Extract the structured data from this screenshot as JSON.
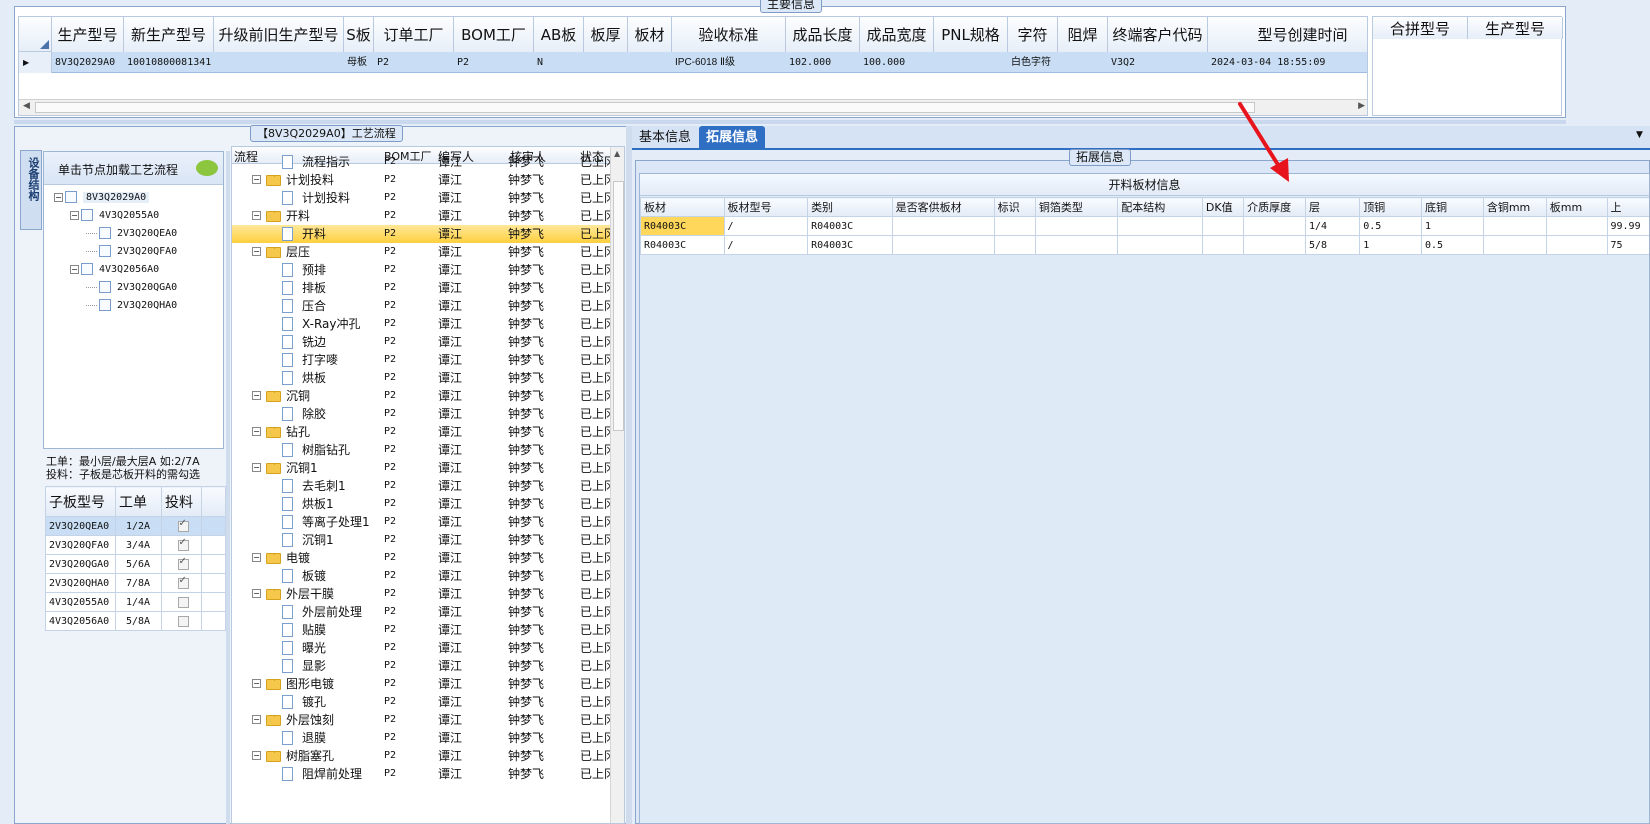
{
  "main_info": {
    "title": "主要信息",
    "columns": [
      "生产型号",
      "新生产型号",
      "升级前旧生产型号",
      "S板",
      "订单工厂",
      "BOM工厂",
      "AB板",
      "板厚",
      "板材",
      "验收标准",
      "成品长度",
      "成品宽度",
      "PNL规格",
      "字符",
      "阻焊",
      "终端客户代码",
      "型号创建时间"
    ],
    "row": [
      "8V3Q2029A0",
      "10010800081341",
      "",
      "母板",
      "P2",
      "P2",
      "N",
      "",
      "",
      "IPC-6018 Ⅱ级",
      "102.000",
      "100.000",
      "",
      "白色字符",
      "",
      "V3Q2",
      "2024-03-04 18:55:09"
    ]
  },
  "merge_panel": {
    "columns": [
      "合拼型号",
      "生产型号"
    ]
  },
  "left_tab": {
    "label": "设备结构"
  },
  "tree": {
    "hint": "单击节点加载工艺流程",
    "nodes": [
      {
        "label": "8V3Q2029A0",
        "level": 0
      },
      {
        "label": "4V3Q2055A0",
        "level": 1
      },
      {
        "label": "2V3Q20QEA0",
        "level": 2
      },
      {
        "label": "2V3Q20QFA0",
        "level": 2
      },
      {
        "label": "4V3Q2056A0",
        "level": 1
      },
      {
        "label": "2V3Q20QGA0",
        "level": 2
      },
      {
        "label": "2V3Q20QHA0",
        "level": 2
      }
    ]
  },
  "workorder_note": {
    "line1": "工单：最小层/最大层A 如:2/7A",
    "line2": "投料：子板是芯板开料的需勾选"
  },
  "sub_grid": {
    "columns": [
      "子板型号",
      "工单",
      "投料"
    ],
    "rows": [
      {
        "model": "2V3Q20QEA0",
        "wo": "1/2A",
        "feed": true
      },
      {
        "model": "2V3Q20QFA0",
        "wo": "3/4A",
        "feed": true
      },
      {
        "model": "2V3Q20QGA0",
        "wo": "5/6A",
        "feed": true
      },
      {
        "model": "2V3Q20QHA0",
        "wo": "7/8A",
        "feed": true
      },
      {
        "model": "4V3Q2055A0",
        "wo": "1/4A",
        "feed": false
      },
      {
        "model": "4V3Q2056A0",
        "wo": "5/8A",
        "feed": false
      }
    ]
  },
  "flow": {
    "title": "【8V3Q2029A0】工艺流程",
    "columns": [
      "流程",
      "BOM工厂",
      "编写人",
      "核审人",
      "状态"
    ],
    "rows": [
      {
        "name": "流程指示",
        "folder": false,
        "bom": "P2",
        "writer": "谭江",
        "auditor": "钟梦飞",
        "status": "已上冈"
      },
      {
        "name": "计划投料",
        "folder": true,
        "bom": "P2",
        "writer": "谭江",
        "auditor": "钟梦飞",
        "status": "已上冈"
      },
      {
        "name": "计划投料",
        "folder": false,
        "bom": "P2",
        "writer": "谭江",
        "auditor": "钟梦飞",
        "status": "已上冈"
      },
      {
        "name": "开料",
        "folder": true,
        "bom": "P2",
        "writer": "谭江",
        "auditor": "钟梦飞",
        "status": "已上冈"
      },
      {
        "name": "开料",
        "folder": false,
        "bom": "P2",
        "writer": "谭江",
        "auditor": "钟梦飞",
        "status": "已上冈",
        "selected": true
      },
      {
        "name": "层压",
        "folder": true,
        "bom": "P2",
        "writer": "谭江",
        "auditor": "钟梦飞",
        "status": "已上冈"
      },
      {
        "name": "预排",
        "folder": false,
        "bom": "P2",
        "writer": "谭江",
        "auditor": "钟梦飞",
        "status": "已上冈"
      },
      {
        "name": "排板",
        "folder": false,
        "bom": "P2",
        "writer": "谭江",
        "auditor": "钟梦飞",
        "status": "已上冈"
      },
      {
        "name": "压合",
        "folder": false,
        "bom": "P2",
        "writer": "谭江",
        "auditor": "钟梦飞",
        "status": "已上冈"
      },
      {
        "name": "X-Ray冲孔",
        "folder": false,
        "bom": "P2",
        "writer": "谭江",
        "auditor": "钟梦飞",
        "status": "已上冈"
      },
      {
        "name": "铣边",
        "folder": false,
        "bom": "P2",
        "writer": "谭江",
        "auditor": "钟梦飞",
        "status": "已上冈"
      },
      {
        "name": "打字嘜",
        "folder": false,
        "bom": "P2",
        "writer": "谭江",
        "auditor": "钟梦飞",
        "status": "已上冈"
      },
      {
        "name": "烘板",
        "folder": false,
        "bom": "P2",
        "writer": "谭江",
        "auditor": "钟梦飞",
        "status": "已上冈"
      },
      {
        "name": "沉铜",
        "folder": true,
        "bom": "P2",
        "writer": "谭江",
        "auditor": "钟梦飞",
        "status": "已上冈"
      },
      {
        "name": "除胶",
        "folder": false,
        "bom": "P2",
        "writer": "谭江",
        "auditor": "钟梦飞",
        "status": "已上冈"
      },
      {
        "name": "钻孔",
        "folder": true,
        "bom": "P2",
        "writer": "谭江",
        "auditor": "钟梦飞",
        "status": "已上冈"
      },
      {
        "name": "树脂钻孔",
        "folder": false,
        "bom": "P2",
        "writer": "谭江",
        "auditor": "钟梦飞",
        "status": "已上冈"
      },
      {
        "name": "沉铜1",
        "folder": true,
        "bom": "P2",
        "writer": "谭江",
        "auditor": "钟梦飞",
        "status": "已上冈"
      },
      {
        "name": "去毛刺1",
        "folder": false,
        "bom": "P2",
        "writer": "谭江",
        "auditor": "钟梦飞",
        "status": "已上冈"
      },
      {
        "name": "烘板1",
        "folder": false,
        "bom": "P2",
        "writer": "谭江",
        "auditor": "钟梦飞",
        "status": "已上冈"
      },
      {
        "name": "等离子处理1",
        "folder": false,
        "bom": "P2",
        "writer": "谭江",
        "auditor": "钟梦飞",
        "status": "已上冈"
      },
      {
        "name": "沉铜1",
        "folder": false,
        "bom": "P2",
        "writer": "谭江",
        "auditor": "钟梦飞",
        "status": "已上冈"
      },
      {
        "name": "电镀",
        "folder": true,
        "bom": "P2",
        "writer": "谭江",
        "auditor": "钟梦飞",
        "status": "已上冈"
      },
      {
        "name": "板镀",
        "folder": false,
        "bom": "P2",
        "writer": "谭江",
        "auditor": "钟梦飞",
        "status": "已上冈"
      },
      {
        "name": "外层干膜",
        "folder": true,
        "bom": "P2",
        "writer": "谭江",
        "auditor": "钟梦飞",
        "status": "已上冈"
      },
      {
        "name": "外层前处理",
        "folder": false,
        "bom": "P2",
        "writer": "谭江",
        "auditor": "钟梦飞",
        "status": "已上冈"
      },
      {
        "name": "贴膜",
        "folder": false,
        "bom": "P2",
        "writer": "谭江",
        "auditor": "钟梦飞",
        "status": "已上冈"
      },
      {
        "name": "曝光",
        "folder": false,
        "bom": "P2",
        "writer": "谭江",
        "auditor": "钟梦飞",
        "status": "已上冈"
      },
      {
        "name": "显影",
        "folder": false,
        "bom": "P2",
        "writer": "谭江",
        "auditor": "钟梦飞",
        "status": "已上冈"
      },
      {
        "name": "图形电镀",
        "folder": true,
        "bom": "P2",
        "writer": "谭江",
        "auditor": "钟梦飞",
        "status": "已上冈"
      },
      {
        "name": "镀孔",
        "folder": false,
        "bom": "P2",
        "writer": "谭江",
        "auditor": "钟梦飞",
        "status": "已上冈"
      },
      {
        "name": "外层蚀刻",
        "folder": true,
        "bom": "P2",
        "writer": "谭江",
        "auditor": "钟梦飞",
        "status": "已上冈"
      },
      {
        "name": "退膜",
        "folder": false,
        "bom": "P2",
        "writer": "谭江",
        "auditor": "钟梦飞",
        "status": "已上冈"
      },
      {
        "name": "树脂塞孔",
        "folder": true,
        "bom": "P2",
        "writer": "谭江",
        "auditor": "钟梦飞",
        "status": "已上冈"
      },
      {
        "name": "阻焊前处理",
        "folder": false,
        "bom": "P2",
        "writer": "谭江",
        "auditor": "钟梦飞",
        "status": "已上冈"
      }
    ]
  },
  "right_tabs": [
    {
      "label": "基本信息",
      "active": false
    },
    {
      "label": "拓展信息",
      "active": true
    }
  ],
  "ext": {
    "group_title": "拓展信息",
    "table_title": "开料板材信息",
    "columns": [
      "板材",
      "板材型号",
      "类别",
      "是否客供板材",
      "标识",
      "铜箔类型",
      "配本结构",
      "DK值",
      "介质厚度",
      "层",
      "顶铜",
      "底铜",
      "含铜mm",
      "板mm",
      "上"
    ],
    "rows": [
      [
        "R04003C",
        "/",
        "R04003C",
        "",
        "",
        "",
        "",
        "",
        "",
        "1/4",
        "0.5",
        "1",
        "",
        "",
        "99.99"
      ],
      [
        "R04003C",
        "/",
        "R04003C",
        "",
        "",
        "",
        "",
        "",
        "",
        "5/8",
        "1",
        "0.5",
        "",
        "",
        "75"
      ]
    ]
  },
  "colors": {
    "accent": "#2f6fc3",
    "selection": "#c9def5",
    "arrow": "#e8141c",
    "highlight": "#ffd75a"
  }
}
